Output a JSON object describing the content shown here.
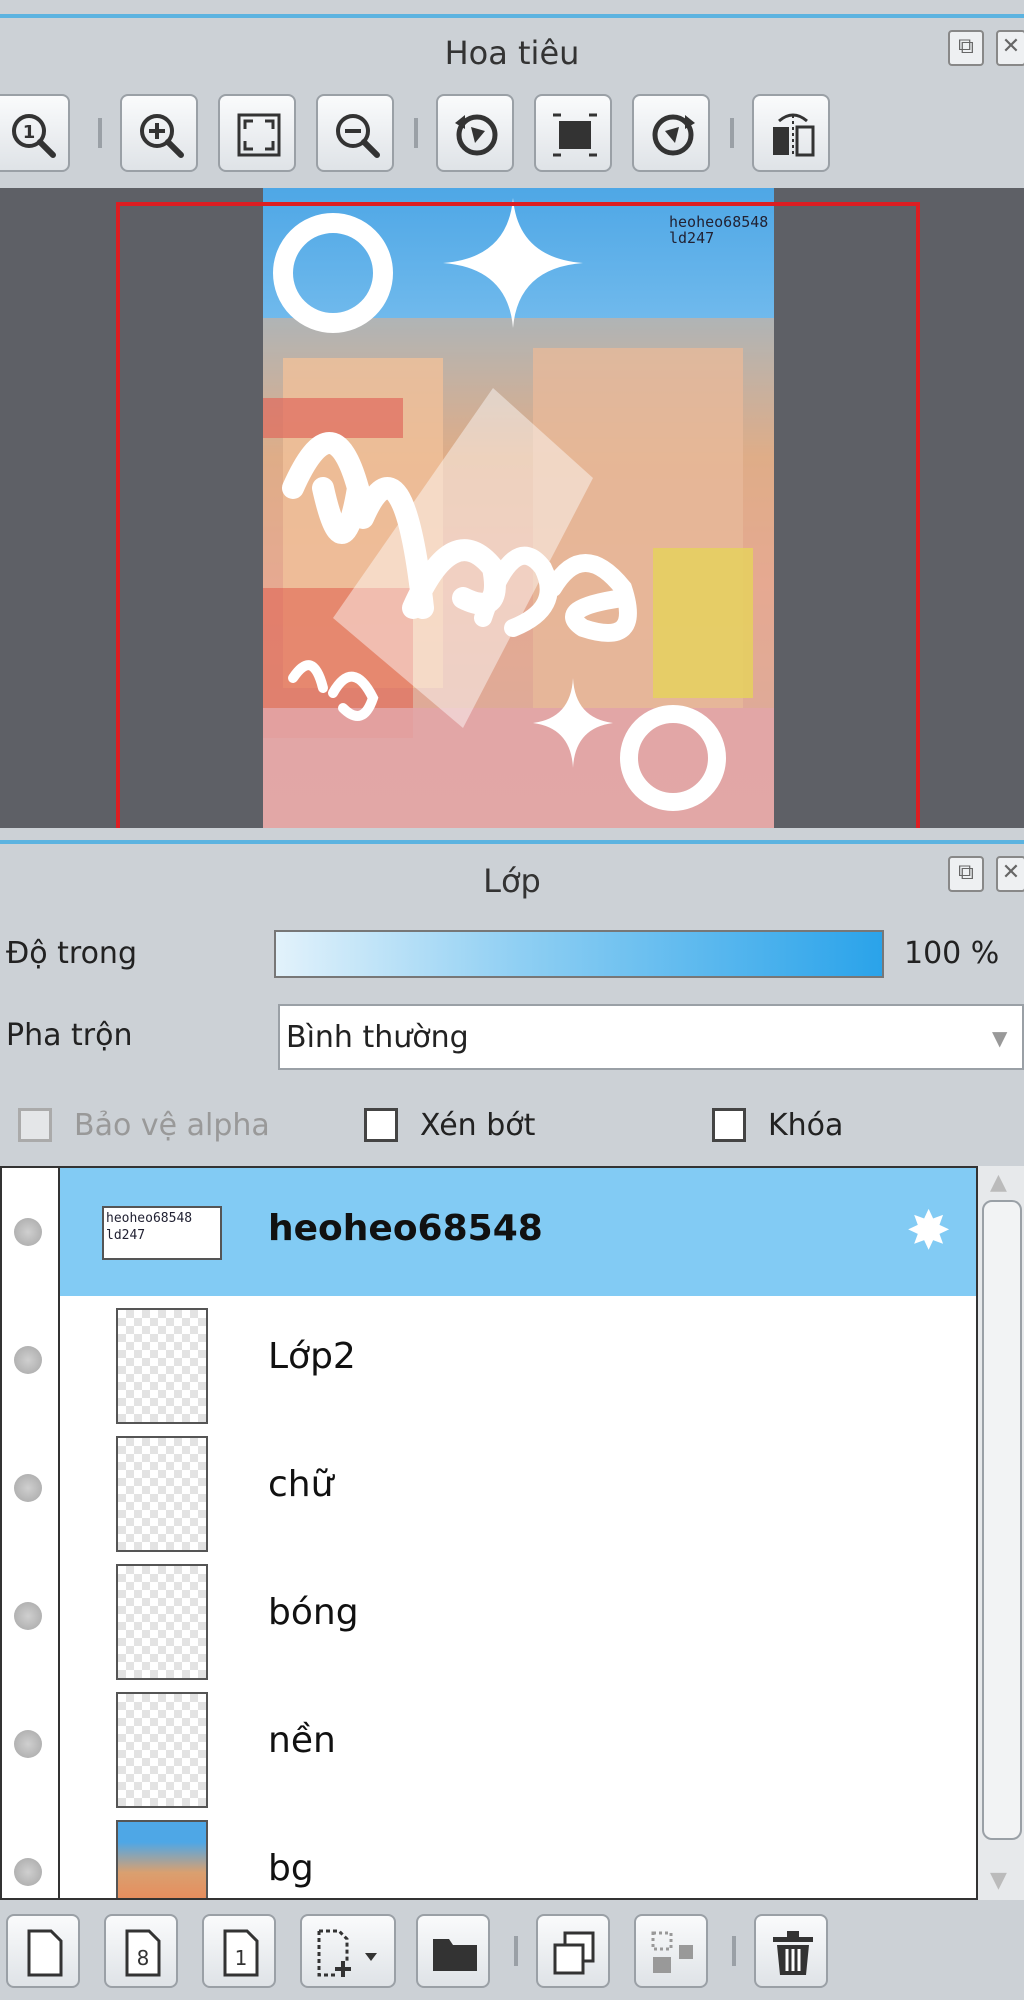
{
  "navigator": {
    "title": "Hoa tiêu",
    "toolbar": [
      "actual-size",
      "zoom-in",
      "fit-to-view",
      "zoom-out",
      "rotate-left",
      "fit-canvas",
      "rotate-right",
      "flip-horizontal"
    ],
    "preview": {
      "watermark_line1": "heoheo68548",
      "watermark_line2": "ld247"
    }
  },
  "layers": {
    "title": "Lớp",
    "opacity_label": "Độ trong",
    "opacity_value": "100 %",
    "opacity_fraction": 1.0,
    "blend_label": "Pha trộn",
    "blend_value": "Bình thường",
    "protect_alpha_label": "Bảo vệ alpha",
    "clip_label": "Xén bớt",
    "lock_label": "Khóa",
    "items": [
      {
        "name": "heoheo68548",
        "selected": true
      },
      {
        "name": "Lớp2",
        "selected": false
      },
      {
        "name": "chữ",
        "selected": false
      },
      {
        "name": "bóng",
        "selected": false
      },
      {
        "name": "nền",
        "selected": false
      },
      {
        "name": "bg",
        "selected": false
      }
    ],
    "thumb_watermark_line1": "heoheo68548",
    "thumb_watermark_line2": "ld247"
  },
  "colors": {
    "accent": "#5cb3e0",
    "selected_row": "#82cbf4",
    "frame": "#dc1e22"
  }
}
